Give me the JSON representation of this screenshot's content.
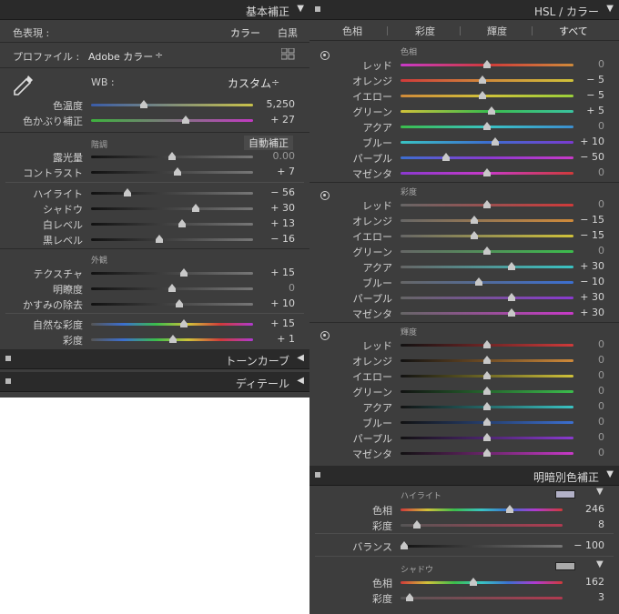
{
  "left": {
    "basic": {
      "title": "基本補正",
      "treatment_label": "色表現 :",
      "treatment_color": "カラー",
      "treatment_bw": "白黒",
      "profile_label": "プロファイル :",
      "profile_value": "Adobe カラー",
      "profile_arrows": "÷",
      "wb_label": "WB :",
      "wb_value": "カスタム",
      "wb_arrows": "÷",
      "temp_label": "色温度",
      "temp_value": "5,250",
      "tint_label": "色かぶり補正",
      "tint_value": "+ 27",
      "tone_sub": "階調",
      "auto_label": "自動補正",
      "exposure_label": "露光量",
      "exposure_value": "0.00",
      "contrast_label": "コントラスト",
      "contrast_value": "+ 7",
      "highlights_label": "ハイライト",
      "highlights_value": "− 56",
      "shadows_label": "シャドウ",
      "shadows_value": "+ 30",
      "whites_label": "白レベル",
      "whites_value": "+ 13",
      "blacks_label": "黒レベル",
      "blacks_value": "− 16",
      "presence_sub": "外観",
      "texture_label": "テクスチャ",
      "texture_value": "+ 15",
      "clarity_label": "明瞭度",
      "clarity_value": "0",
      "dehaze_label": "かすみの除去",
      "dehaze_value": "+ 10",
      "vibrance_label": "自然な彩度",
      "vibrance_value": "+ 15",
      "saturation_label": "彩度",
      "saturation_value": "+ 1"
    },
    "tone_curve_title": "トーンカーブ",
    "detail_title": "ディテール"
  },
  "right": {
    "hsl": {
      "title": "HSL / カラー",
      "tabs": [
        "色相",
        "彩度",
        "輝度",
        "すべて"
      ],
      "hue_sub": "色相",
      "sat_sub": "彩度",
      "lum_sub": "輝度",
      "colors": [
        "レッド",
        "オレンジ",
        "イエロー",
        "グリーン",
        "アクア",
        "ブルー",
        "パープル",
        "マゼンタ"
      ],
      "hue_values": [
        "0",
        "− 5",
        "− 5",
        "+ 5",
        "0",
        "+ 10",
        "− 50",
        "0"
      ],
      "sat_values": [
        "0",
        "− 15",
        "− 15",
        "0",
        "+ 30",
        "− 10",
        "+ 30",
        "+ 30"
      ],
      "lum_values": [
        "0",
        "0",
        "0",
        "0",
        "0",
        "0",
        "0",
        "0"
      ]
    },
    "split": {
      "title": "明暗別色補正",
      "hl_sub": "ハイライト",
      "hl_hue_label": "色相",
      "hl_hue_value": "246",
      "hl_sat_label": "彩度",
      "hl_sat_value": "8",
      "balance_label": "バランス",
      "balance_value": "− 100",
      "sh_sub": "シャドウ",
      "sh_hue_label": "色相",
      "sh_hue_value": "162",
      "sh_sat_label": "彩度",
      "sh_sat_value": "3"
    }
  }
}
